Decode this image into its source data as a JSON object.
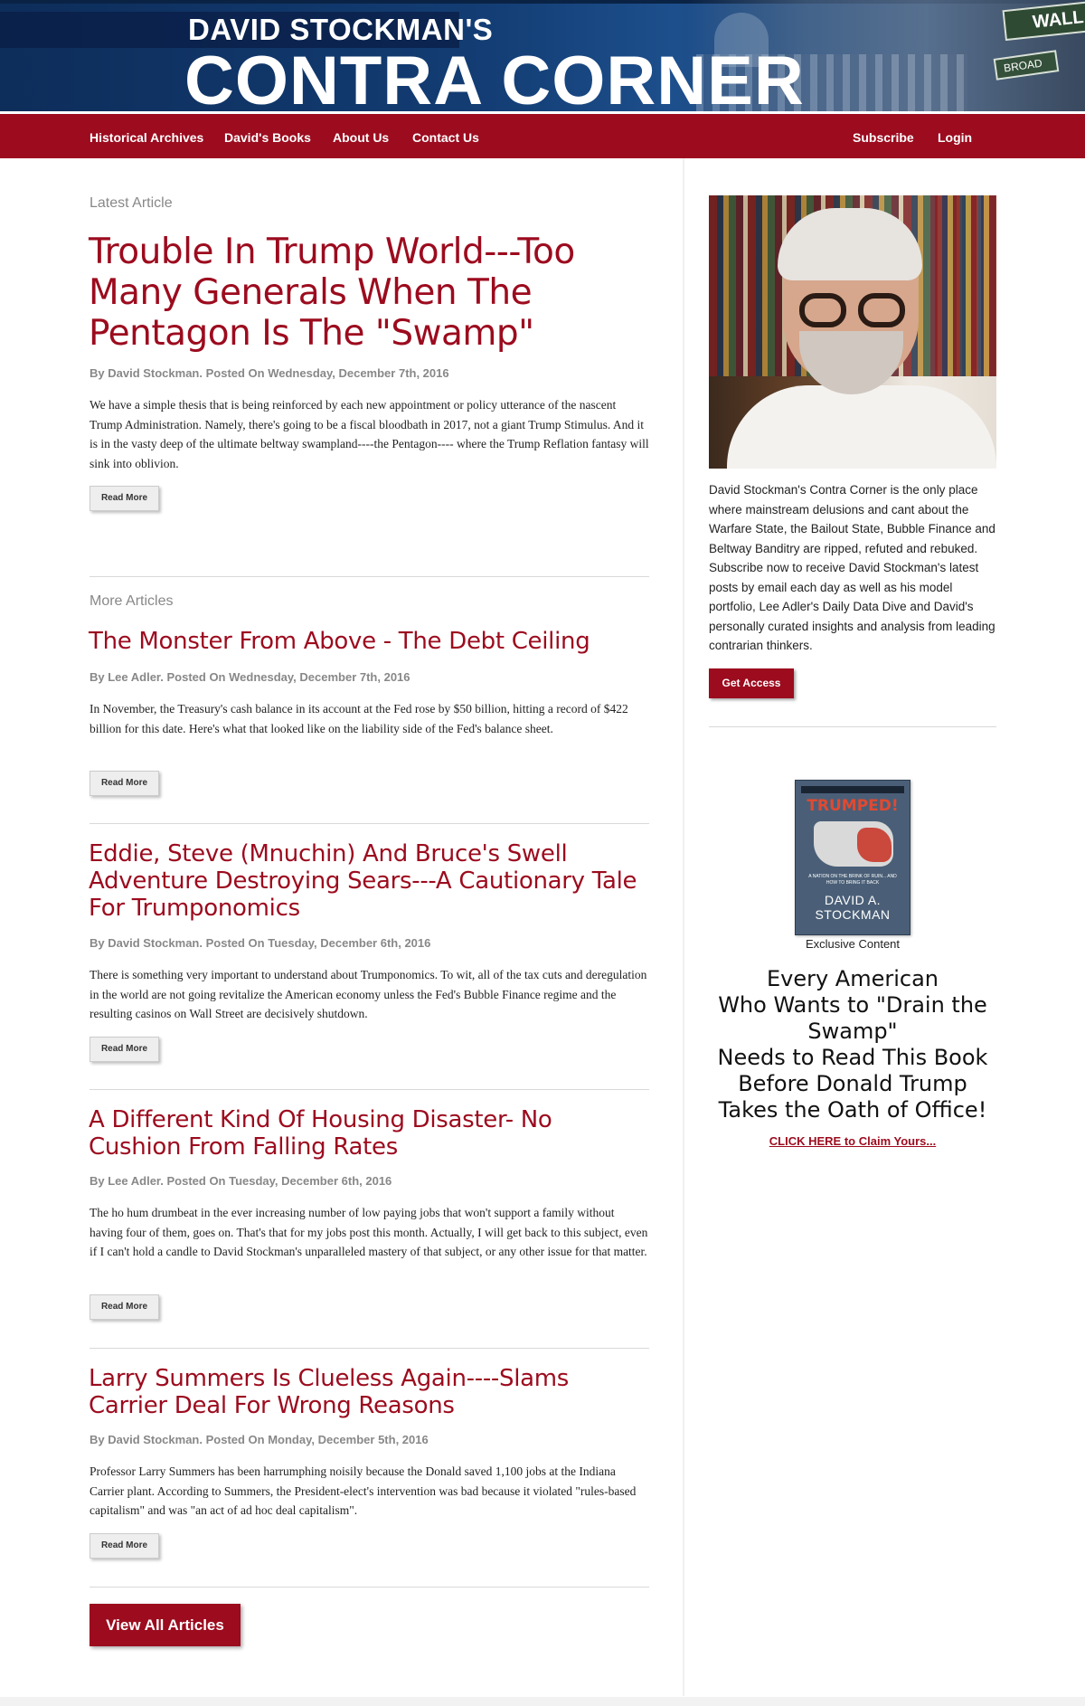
{
  "brand": {
    "title_small": "DAVID STOCKMAN'S",
    "title_big": "CONTRA CORNER",
    "sign_text": "WALL",
    "sign2_text": "BROAD"
  },
  "nav": {
    "left": [
      "Historical Archives",
      "David's Books",
      "About Us",
      "Contact Us"
    ],
    "right": [
      "Subscribe",
      "Login"
    ]
  },
  "latest": {
    "label": "Latest Article",
    "title": "Trouble In Trump World---Too Many Generals When The Pentagon Is The \"Swamp\"",
    "byline": "By David Stockman. Posted On Wednesday, December 7th, 2016",
    "excerpt": "We have a simple thesis that is being reinforced by each new appointment or policy utterance of the nascent Trump Administration. Namely, there's going to be a fiscal bloodbath in 2017, not a giant Trump Stimulus. And it is in the vasty deep of the ultimate beltway swampland----the Pentagon---- where the Trump Reflation fantasy will sink into oblivion.",
    "read_more": "Read More"
  },
  "more": {
    "label": "More Articles",
    "articles": [
      {
        "title": "The Monster From Above - The Debt Ceiling",
        "byline": "By Lee Adler. Posted On Wednesday, December 7th, 2016",
        "excerpt": "In November, the Treasury's cash balance in its account at the Fed rose by $50 billion, hitting a record of $422 billion for this date. Here's what that looked like on the liability side of the Fed's balance sheet.",
        "read_more": "Read More"
      },
      {
        "title": "Eddie, Steve (Mnuchin) And Bruce's Swell Adventure Destroying Sears---A Cautionary Tale For Trumponomics",
        "byline": "By David Stockman. Posted On Tuesday, December 6th, 2016",
        "excerpt": "There is something very important to understand about Trumponomics. To wit, all of the tax cuts and deregulation in the world are not going revitalize the American economy unless the Fed's Bubble Finance regime and the resulting casinos on Wall Street are decisively shutdown.",
        "read_more": "Read More"
      },
      {
        "title": "A Different Kind Of Housing Disaster- No Cushion From Falling Rates",
        "byline": "By Lee Adler. Posted On Tuesday, December 6th, 2016",
        "excerpt": "The ho hum drumbeat in the ever increasing number of low paying jobs that won't support a family without having four of them, goes on. That's that for my jobs post this month. Actually, I will get back to this subject, even if I can't hold a candle to David Stockman's unparalleled mastery of that subject, or any other issue for that matter.",
        "read_more": "Read More"
      },
      {
        "title": "Larry Summers Is Clueless Again----Slams Carrier Deal For Wrong Reasons",
        "byline": "By David Stockman. Posted On Monday, December 5th, 2016",
        "excerpt": "Professor Larry Summers has been harrumphing noisily because the Donald saved 1,100 jobs at the Indiana Carrier plant. According to Summers, the President-elect's intervention was bad because it violated \"rules-based capitalism\" and was \"an act of ad hoc deal capitalism\".",
        "read_more": "Read More"
      }
    ],
    "view_all": "View All Articles"
  },
  "sidebar": {
    "description": "David Stockman's Contra Corner is the only place where mainstream delusions and cant about the Warfare State, the Bailout State, Bubble Finance and Beltway Banditry are ripped, refuted and rebuked. Subscribe now to receive David Stockman's latest posts by email each day as well as his model portfolio, Lee Adler's Daily Data Dive and David's personally curated insights and analysis from leading contrarian thinkers.",
    "get_access": "Get Access",
    "book": {
      "title": "TRUMPED!",
      "subtitle": "A NATION ON THE BRINK OF RUIN... AND HOW TO BRING IT BACK",
      "author_line1": "DAVID A.",
      "author_line2": "STOCKMAN"
    },
    "exclusive": "Exclusive Content",
    "promo_lines": [
      "Every American",
      "Who Wants to \"Drain the Swamp\"",
      "Needs to Read This Book",
      "Before Donald Trump",
      "Takes the Oath of Office!"
    ],
    "claim": "CLICK HERE to Claim Yours..."
  }
}
